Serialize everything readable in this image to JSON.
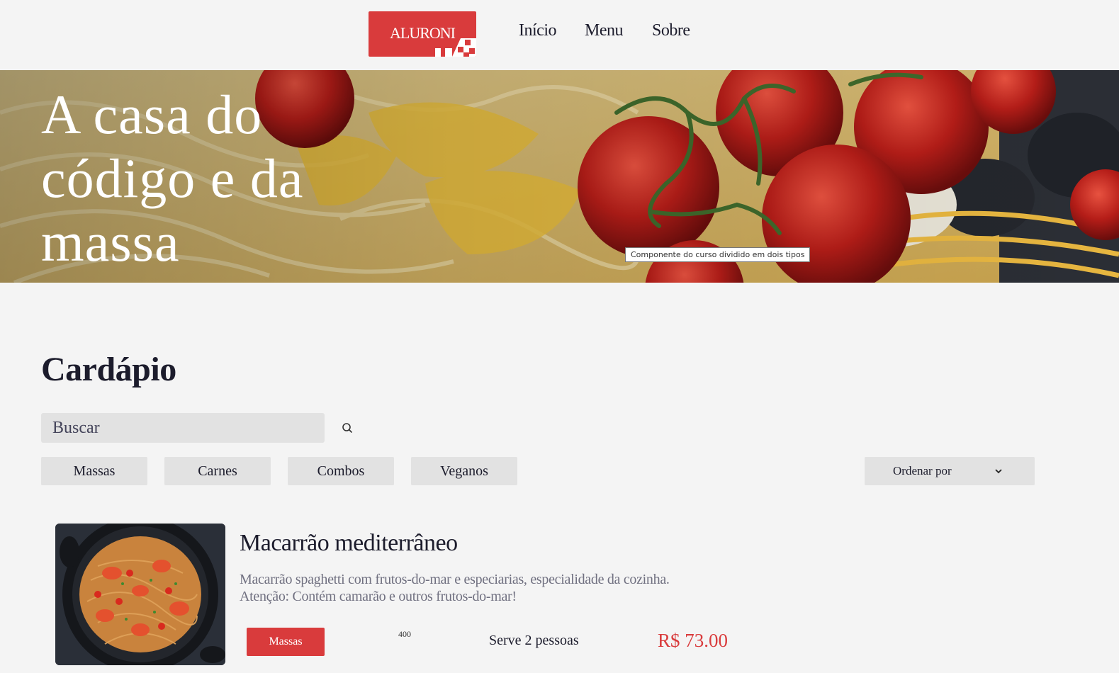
{
  "header": {
    "logo_text": "ALURONI",
    "nav": [
      "Início",
      "Menu",
      "Sobre"
    ]
  },
  "hero": {
    "title": "A casa do código e da massa",
    "tag": "Componente do curso dividido em dois tipos"
  },
  "menu": {
    "title": "Cardápio",
    "search_placeholder": "Buscar",
    "filters": [
      "Massas",
      "Carnes",
      "Combos",
      "Veganos"
    ],
    "sort_label": "Ordenar por"
  },
  "item": {
    "title": "Macarrão mediterrâneo",
    "description": "Macarrão spaghetti com frutos-do-mar e especiarias, especialidade da cozinha. Atenção: Contém camarão e outros frutos-do-mar!",
    "category": "Massas",
    "size": "400",
    "serves": "Serve 2 pessoas",
    "price": "R$ 73.00"
  },
  "colors": {
    "accent": "#d93b3c",
    "background": "#f4f4f4",
    "button_bg": "#e2e2e2"
  }
}
